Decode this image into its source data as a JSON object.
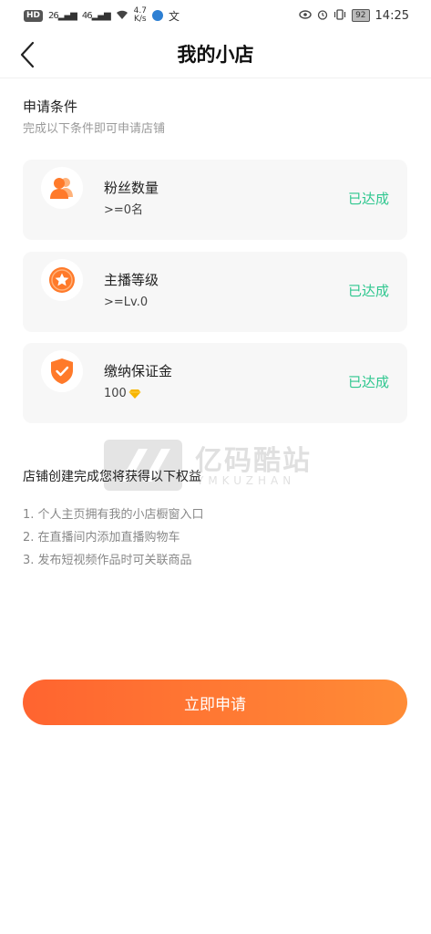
{
  "status_bar": {
    "hd_badge": "HD",
    "signal_1": "26",
    "signal_2": "46",
    "speed_value": "4.7",
    "speed_unit": "K/s",
    "battery": "92",
    "time": "14:25"
  },
  "header": {
    "title": "我的小店",
    "back_icon": "chevron-left-icon"
  },
  "conditions": {
    "title": "申请条件",
    "subtitle": "完成以下条件即可申请店铺",
    "items": [
      {
        "name": "粉丝数量",
        "requirement": ">=0名",
        "status": "已达成",
        "icon": "fans-icon"
      },
      {
        "name": "主播等级",
        "requirement": ">=Lv.0",
        "status": "已达成",
        "icon": "star-badge-icon"
      },
      {
        "name": "缴纳保证金",
        "requirement": "100",
        "status": "已达成",
        "icon": "shield-check-icon",
        "currency_icon": "diamond-icon"
      }
    ]
  },
  "watermark": {
    "text": "亿码酷站",
    "sub": "YMKUZHAN"
  },
  "benefits": {
    "title": "店铺创建完成您将获得以下权益",
    "items": [
      "1. 个人主页拥有我的小店橱窗入口",
      "2. 在直播间内添加直播购物车",
      "3. 发布短视频作品时可关联商品"
    ]
  },
  "apply_button": {
    "label": "立即申请"
  },
  "colors": {
    "accent": "#ff6f32",
    "success": "#2fc78f",
    "icon_orange": "#ff7a2a"
  }
}
